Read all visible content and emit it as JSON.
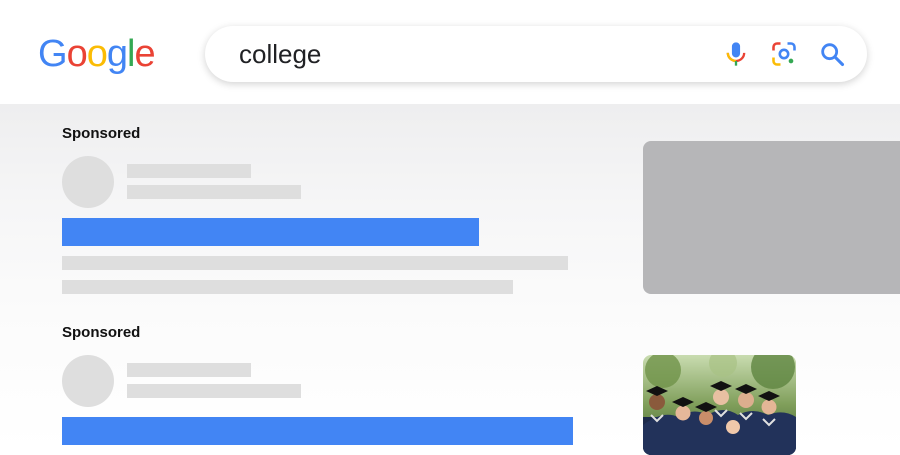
{
  "logo": {
    "letters": [
      "G",
      "o",
      "o",
      "g",
      "l",
      "e"
    ],
    "colors": [
      "#4285F4",
      "#EA4335",
      "#FBBC05",
      "#4285F4",
      "#34A853",
      "#EA4335"
    ]
  },
  "search": {
    "query": "college",
    "icons": [
      "mic-icon",
      "google-lens-icon",
      "search-icon"
    ]
  },
  "ads": [
    {
      "label": "Sponsored"
    },
    {
      "label": "Sponsored"
    }
  ],
  "colors": {
    "link_blue": "#4285F4",
    "placeholder_gray": "#DEDEDE",
    "image_placeholder": "#B6B6B8"
  }
}
